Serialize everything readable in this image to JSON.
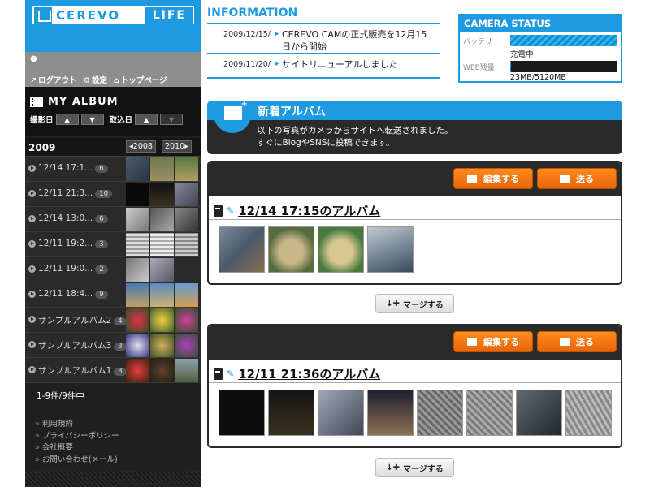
{
  "logo": {
    "name": "CEREVO",
    "suffix": "LIFE"
  },
  "user_links": {
    "logout": "ログアウト",
    "settings": "設定",
    "toppage": "トップページ"
  },
  "album": {
    "title": "MY ALBUM",
    "sort_shoot": "撮影日",
    "sort_import": "取込日",
    "year": "2009",
    "prev_year": "2008",
    "next_year": "2010",
    "list_count": "1-9件/9件中",
    "items": [
      {
        "label": "12/14 17:1...",
        "count": "6"
      },
      {
        "label": "12/11 21:3...",
        "count": "10"
      },
      {
        "label": "12/14 13:0...",
        "count": "6"
      },
      {
        "label": "12/11 19:2...",
        "count": "3"
      },
      {
        "label": "12/11 19:0...",
        "count": "2"
      },
      {
        "label": "12/11 18:4...",
        "count": "9"
      },
      {
        "label": "サンプルアルバム2",
        "count": "4"
      },
      {
        "label": "サンプルアルバム3",
        "count": "3"
      },
      {
        "label": "サンプルアルバム1",
        "count": "3"
      }
    ]
  },
  "footer": {
    "terms": "利用規約",
    "privacy": "プライバシーポリシー",
    "company": "会社概要",
    "contact": "お問い合わせ(メール)"
  },
  "info": {
    "title": "INFORMATION",
    "items": [
      {
        "date": "2009/12/15/",
        "text": "CEREVO CAMの正式販売を12月15日から開始"
      },
      {
        "date": "2009/11/20/",
        "text": "サイトリニューアルしました"
      }
    ]
  },
  "camera": {
    "title": "CAMERA STATUS",
    "battery_label": "バッテリー",
    "battery_status": "充電中",
    "battery_level": 1.0,
    "storage_label": "WEB残量",
    "storage_value": "23MB/5120MB",
    "storage_level": 0.0045
  },
  "new_album": {
    "title": "新着アルバム",
    "desc1": "以下の写真がカメラからサイトへ転送されました。",
    "desc2": "すぐにBlogやSNSに投稿できます。"
  },
  "panels": [
    {
      "title": "12/14 17:15のアルバム",
      "edit": "編集する",
      "send": "送る",
      "merge": "マージする"
    },
    {
      "title": "12/11 21:36のアルバム",
      "edit": "編集する",
      "send": "送る",
      "merge": "マージする"
    }
  ],
  "colors": {
    "accent": "#1e9ae0",
    "orange": "#f07810",
    "dark": "#2a2a2a"
  }
}
